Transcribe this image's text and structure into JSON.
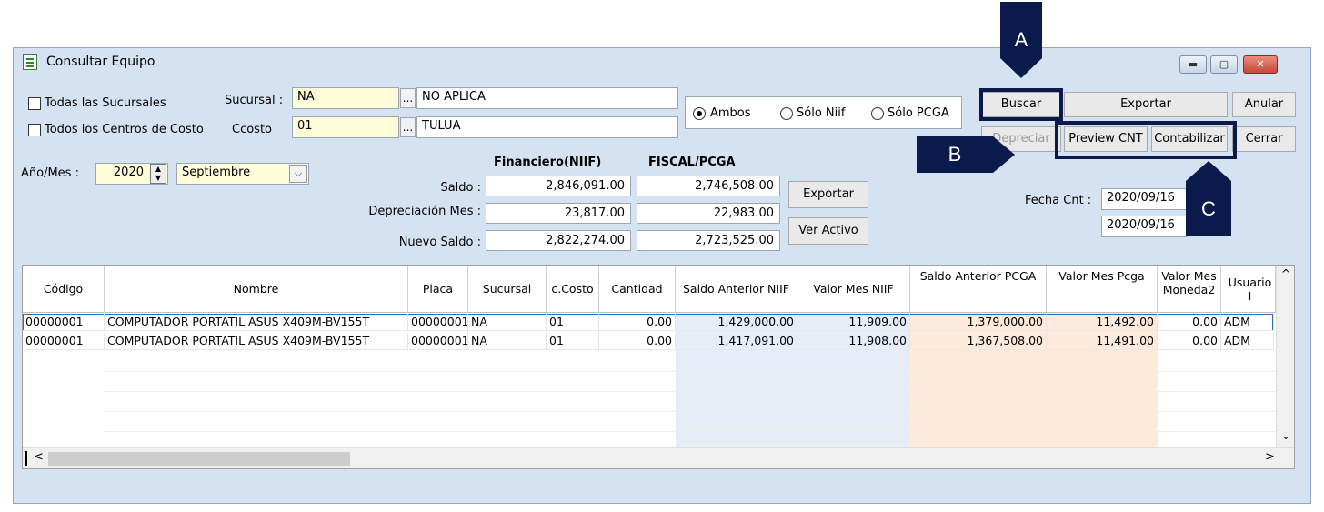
{
  "window": {
    "title": "Consultar Equipo"
  },
  "filters": {
    "todas_sucursales": "Todas las Sucursales",
    "todos_centros": "Todos los Centros de Costo",
    "sucursal_label": "Sucursal :",
    "sucursal_code": "NA",
    "sucursal_name": "NO APLICA",
    "ccosto_label": "Ccosto",
    "ccosto_code": "01",
    "ccosto_name": "TULUA",
    "dots": "...",
    "anio_mes_label": "Año/Mes :",
    "anio": "2020",
    "mes": "Septiembre"
  },
  "radios": {
    "ambos": "Ambos",
    "solo_niif": "Sólo Niif",
    "solo_pcga": "Sólo PCGA",
    "selected": "Ambos"
  },
  "buttons": {
    "buscar": "Buscar",
    "exportar_top": "Exportar",
    "anular": "Anular",
    "depreciar": "Depreciar",
    "preview_cnt": "Preview CNT",
    "contabilizar": "Contabilizar",
    "cerrar": "Cerrar",
    "exportar_mid": "Exportar",
    "ver_activo": "Ver Activo"
  },
  "summary": {
    "financiero_header": "Financiero(NIIF)",
    "fiscal_header": "FISCAL/PCGA",
    "saldo_label": "Saldo :",
    "depreciacion_label": "Depreciación Mes :",
    "nuevo_saldo_label": "Nuevo Saldo :",
    "saldo_niif": "2,846,091.00",
    "saldo_pcga": "2,746,508.00",
    "dep_niif": "23,817.00",
    "dep_pcga": "22,983.00",
    "nuevo_niif": "2,822,274.00",
    "nuevo_pcga": "2,723,525.00"
  },
  "fecha": {
    "label": "Fecha Cnt :",
    "fecha1": "2020/09/16",
    "fecha2": "2020/09/16"
  },
  "grid": {
    "columns": [
      "Código",
      "Nombre",
      "Placa",
      "Sucursal",
      "c.Costo",
      "Cantidad",
      "Saldo Anterior NIIF",
      "Valor Mes NIIF",
      "Saldo Anterior PCGA",
      "Valor Mes Pcga",
      "Valor Mes Moneda2",
      "Usuario I"
    ],
    "rows": [
      [
        "00000001",
        "COMPUTADOR PORTATIL ASUS X409M-BV155T",
        "00000001",
        "NA",
        "01",
        "0.00",
        "1,429,000.00",
        "11,909.00",
        "1,379,000.00",
        "11,492.00",
        "0.00",
        "ADM"
      ],
      [
        "00000001",
        "COMPUTADOR PORTATIL ASUS X409M-BV155T",
        "00000001",
        "NA",
        "01",
        "0.00",
        "1,417,091.00",
        "11,908.00",
        "1,367,508.00",
        "11,491.00",
        "0.00",
        "ADM"
      ]
    ]
  },
  "annotations": {
    "a": "A",
    "b": "B",
    "c": "C"
  },
  "colors": {
    "niif_column": "#e6edf7",
    "pcga_column": "#fdeadb",
    "callout": "#0a1a4a"
  }
}
